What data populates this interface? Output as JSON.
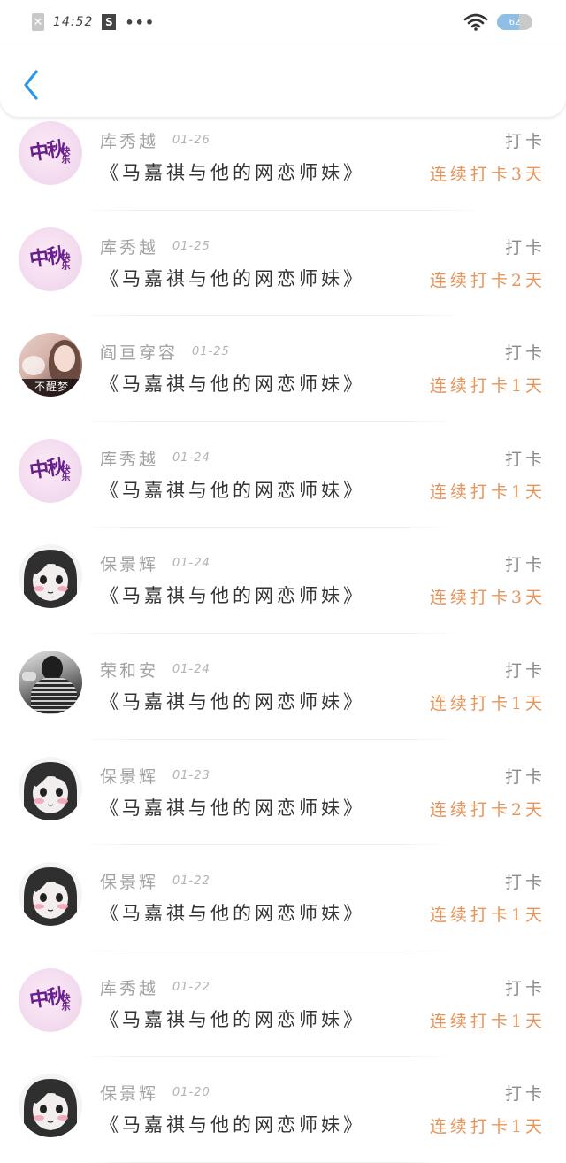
{
  "status_bar": {
    "time": "14:52",
    "dots": "•••",
    "battery_level": "62",
    "battery_fraction": 0.62
  },
  "colors": {
    "accent_blue": "#2a9ae8",
    "streak_orange": "#e8955a",
    "name_gray": "#a2a2a2",
    "title_dark": "#333333"
  },
  "rows": [
    {
      "name": "库秀越",
      "date": "01-26",
      "title": "《马嘉祺与他的网恋师妹》",
      "action": "打卡",
      "streak": "连续打卡3天",
      "avatar": "mid-autumn-avatar"
    },
    {
      "name": "库秀越",
      "date": "01-25",
      "title": "《马嘉祺与他的网恋师妹》",
      "action": "打卡",
      "streak": "连续打卡2天",
      "avatar": "mid-autumn-avatar"
    },
    {
      "name": "阎亘穿容",
      "date": "01-25",
      "title": "《马嘉祺与他的网恋师妹》",
      "action": "打卡",
      "streak": "连续打卡1天",
      "avatar": "photo-avatar",
      "avatar_caption": "不醒梦"
    },
    {
      "name": "库秀越",
      "date": "01-24",
      "title": "《马嘉祺与他的网恋师妹》",
      "action": "打卡",
      "streak": "连续打卡1天",
      "avatar": "mid-autumn-avatar"
    },
    {
      "name": "保景辉",
      "date": "01-24",
      "title": "《马嘉祺与他的网恋师妹》",
      "action": "打卡",
      "streak": "连续打卡3天",
      "avatar": "sketch-avatar"
    },
    {
      "name": "荣和安",
      "date": "01-24",
      "title": "《马嘉祺与他的网恋师妹》",
      "action": "打卡",
      "streak": "连续打卡1天",
      "avatar": "bw-photo-avatar"
    },
    {
      "name": "保景辉",
      "date": "01-23",
      "title": "《马嘉祺与他的网恋师妹》",
      "action": "打卡",
      "streak": "连续打卡2天",
      "avatar": "sketch-avatar"
    },
    {
      "name": "保景辉",
      "date": "01-22",
      "title": "《马嘉祺与他的网恋师妹》",
      "action": "打卡",
      "streak": "连续打卡1天",
      "avatar": "sketch-avatar"
    },
    {
      "name": "库秀越",
      "date": "01-22",
      "title": "《马嘉祺与他的网恋师妹》",
      "action": "打卡",
      "streak": "连续打卡1天",
      "avatar": "mid-autumn-avatar"
    },
    {
      "name": "保景辉",
      "date": "01-20",
      "title": "《马嘉祺与他的网恋师妹》",
      "action": "打卡",
      "streak": "连续打卡1天",
      "avatar": "sketch-avatar"
    }
  ],
  "avatar_art": {
    "mid_autumn_main": "中秋",
    "mid_autumn_sub": "快乐"
  }
}
